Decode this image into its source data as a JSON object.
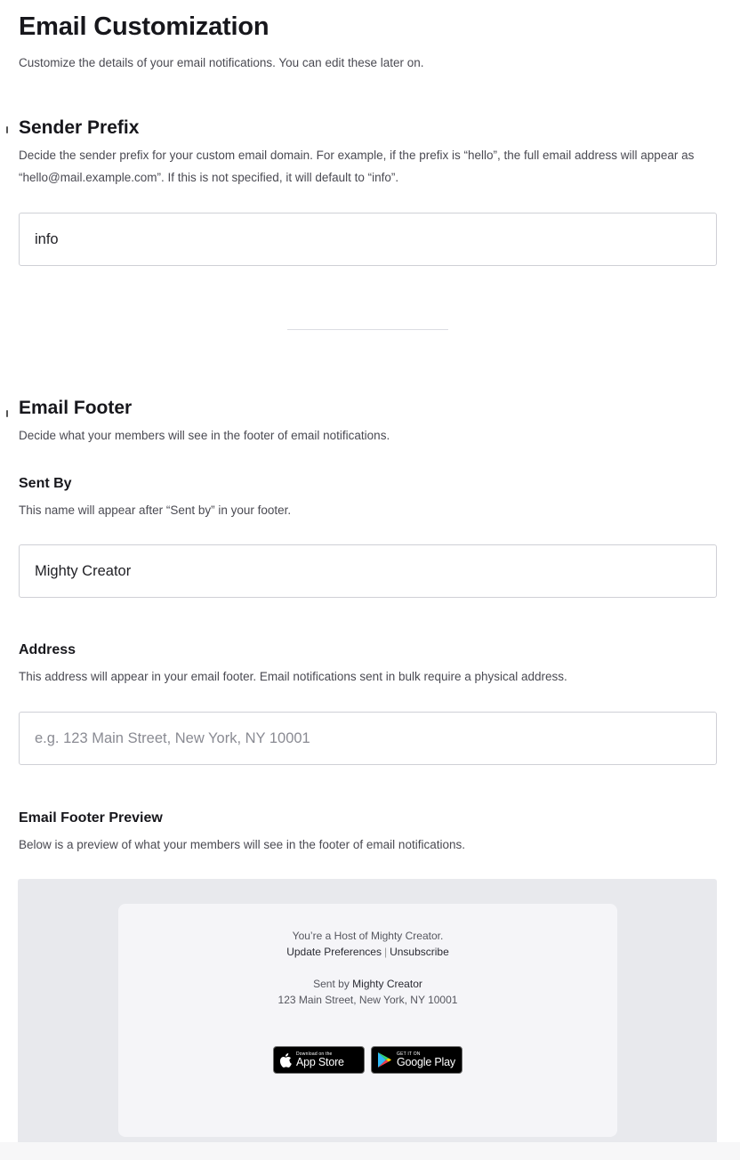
{
  "header": {
    "title": "Email Customization",
    "subtitle": "Customize the details of your email notifications. You can edit these later on."
  },
  "sender_prefix": {
    "title": "Sender Prefix",
    "description": "Decide the sender prefix for your custom email domain. For example, if the prefix is “hello”, the full email address will appear as “hello@mail.example.com”. If this is not specified, it will default to “info”.",
    "value": "info"
  },
  "email_footer": {
    "title": "Email Footer",
    "description": "Decide what your members will see in the footer of email notifications.",
    "sent_by": {
      "label": "Sent By",
      "description": "This name will appear after “Sent by” in your footer.",
      "value": "Mighty Creator"
    },
    "address": {
      "label": "Address",
      "description": "This address will appear in your email footer. Email notifications sent in bulk require a physical address.",
      "value": "",
      "placeholder": "e.g. 123 Main Street, New York, NY 10001"
    }
  },
  "preview": {
    "title": "Email Footer Preview",
    "description": "Below is a preview of what your members will see in the footer of email notifications.",
    "host_line": "You’re a Host of Mighty Creator.",
    "update_preferences": "Update Preferences",
    "separator": "|",
    "unsubscribe": "Unsubscribe",
    "sent_by_prefix": "Sent by",
    "sent_by_name": "Mighty Creator",
    "address_line": "123 Main Street, New York, NY 10001",
    "app_store_small": "Download on the",
    "app_store_big": "App Store",
    "google_play_small": "GET IT ON",
    "google_play_big": "Google Play"
  }
}
